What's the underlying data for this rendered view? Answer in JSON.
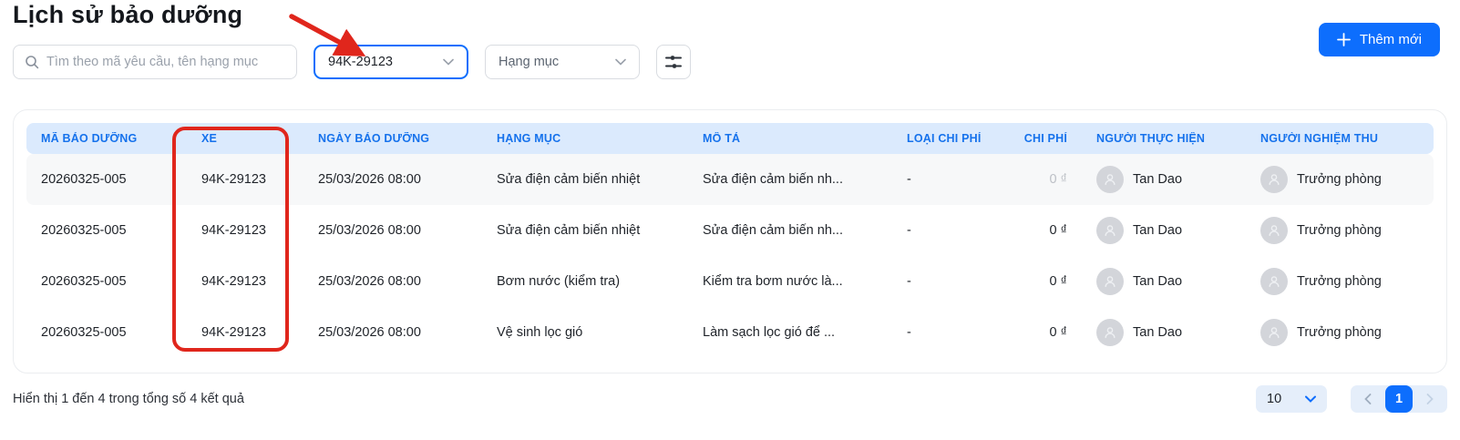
{
  "page": {
    "title": "Lịch sử bảo dưỡng"
  },
  "toolbar": {
    "search_placeholder": "Tìm theo mã yêu cầu, tên hạng mục",
    "vehicle_filter_value": "94K-29123",
    "category_filter_label": "Hạng mục",
    "filter_button_icon": "sliders-icon",
    "add_button_label": "Thêm mới"
  },
  "table": {
    "columns": [
      "MÃ BẢO DƯỠNG",
      "XE",
      "NGÀY BẢO DƯỠNG",
      "HẠNG MỤC",
      "MÔ TẢ",
      "LOẠI CHI PHÍ",
      "CHI PHÍ",
      "NGƯỜI THỰC HIỆN",
      "NGƯỜI NGHIỆM THU"
    ],
    "rows": [
      {
        "code": "20260325-005",
        "vehicle": "94K-29123",
        "date": "25/03/2026 08:00",
        "category": "Sửa điện cảm biến nhiệt",
        "description": "Sửa điện cảm biến nh...",
        "cost_type": "-",
        "cost": "0 ₫",
        "cost_muted": true,
        "performer": "Tan Dao",
        "approver": "Trưởng phòng"
      },
      {
        "code": "20260325-005",
        "vehicle": "94K-29123",
        "date": "25/03/2026 08:00",
        "category": "Sửa điện cảm biến nhiệt",
        "description": "Sửa điện cảm biến nh...",
        "cost_type": "-",
        "cost": "0 ₫",
        "cost_muted": false,
        "performer": "Tan Dao",
        "approver": "Trưởng phòng"
      },
      {
        "code": "20260325-005",
        "vehicle": "94K-29123",
        "date": "25/03/2026 08:00",
        "category": "Bơm nước (kiểm tra)",
        "description": "Kiểm tra bơm nước là...",
        "cost_type": "-",
        "cost": "0 ₫",
        "cost_muted": false,
        "performer": "Tan Dao",
        "approver": "Trưởng phòng"
      },
      {
        "code": "20260325-005",
        "vehicle": "94K-29123",
        "date": "25/03/2026 08:00",
        "category": "Vệ sinh lọc gió",
        "description": "Làm sạch lọc gió để ...",
        "cost_type": "-",
        "cost": "0 ₫",
        "cost_muted": false,
        "performer": "Tan Dao",
        "approver": "Trưởng phòng"
      }
    ]
  },
  "footer": {
    "summary": "Hiển thị 1 đến 4 trong tổng số 4 kết quả",
    "page_size": "10",
    "current_page": "1"
  },
  "annotations": {
    "color": "#e0261c",
    "arrow_points_to": "vehicle-filter",
    "box_highlights": "xe-column"
  },
  "colors": {
    "accent_blue": "#0d6efd",
    "header_bg": "#dbeafd",
    "header_text": "#1672ec",
    "row_highlight": "#f7f8f9",
    "annotation_red": "#e0261c"
  }
}
